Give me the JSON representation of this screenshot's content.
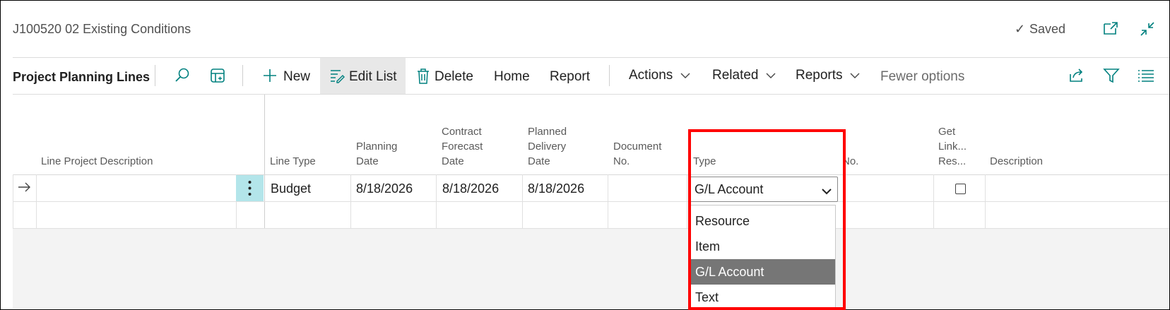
{
  "window": {
    "title": "J100520 02 Existing Conditions",
    "status": "Saved"
  },
  "toolbar": {
    "page_name": "Project Planning Lines",
    "new_label": "New",
    "edit_list_label": "Edit List",
    "delete_label": "Delete",
    "home_label": "Home",
    "report_label": "Report",
    "actions_label": "Actions",
    "related_label": "Related",
    "reports_label": "Reports",
    "fewer_options_label": "Fewer options"
  },
  "columns": {
    "line_project_description": "Line Project Description",
    "line_type": "Line Type",
    "planning_date": [
      "Planning",
      "Date"
    ],
    "contract_forecast_date": [
      "Contract",
      "Forecast",
      "Date"
    ],
    "planned_delivery_date": [
      "Planned",
      "Delivery",
      "Date"
    ],
    "document_no": [
      "Document",
      "No."
    ],
    "type": "Type",
    "no": "No.",
    "get_link_res": [
      "Get",
      "Link...",
      "Res..."
    ],
    "description": "Description"
  },
  "rows": [
    {
      "line_type": "Budget",
      "planning_date": "8/18/2026",
      "contract_forecast_date": "8/18/2026",
      "planned_delivery_date": "8/18/2026",
      "type": "G/L Account",
      "get_link_res": false
    }
  ],
  "type_dropdown": {
    "options": [
      "Resource",
      "Item",
      "G/L Account",
      "Text"
    ],
    "selected": "G/L Account"
  },
  "colors": {
    "accent": "#00807f",
    "highlight_box": "#ff0000",
    "selected_option_bg": "#767676",
    "row_action_bg": "#b3e5ea"
  }
}
